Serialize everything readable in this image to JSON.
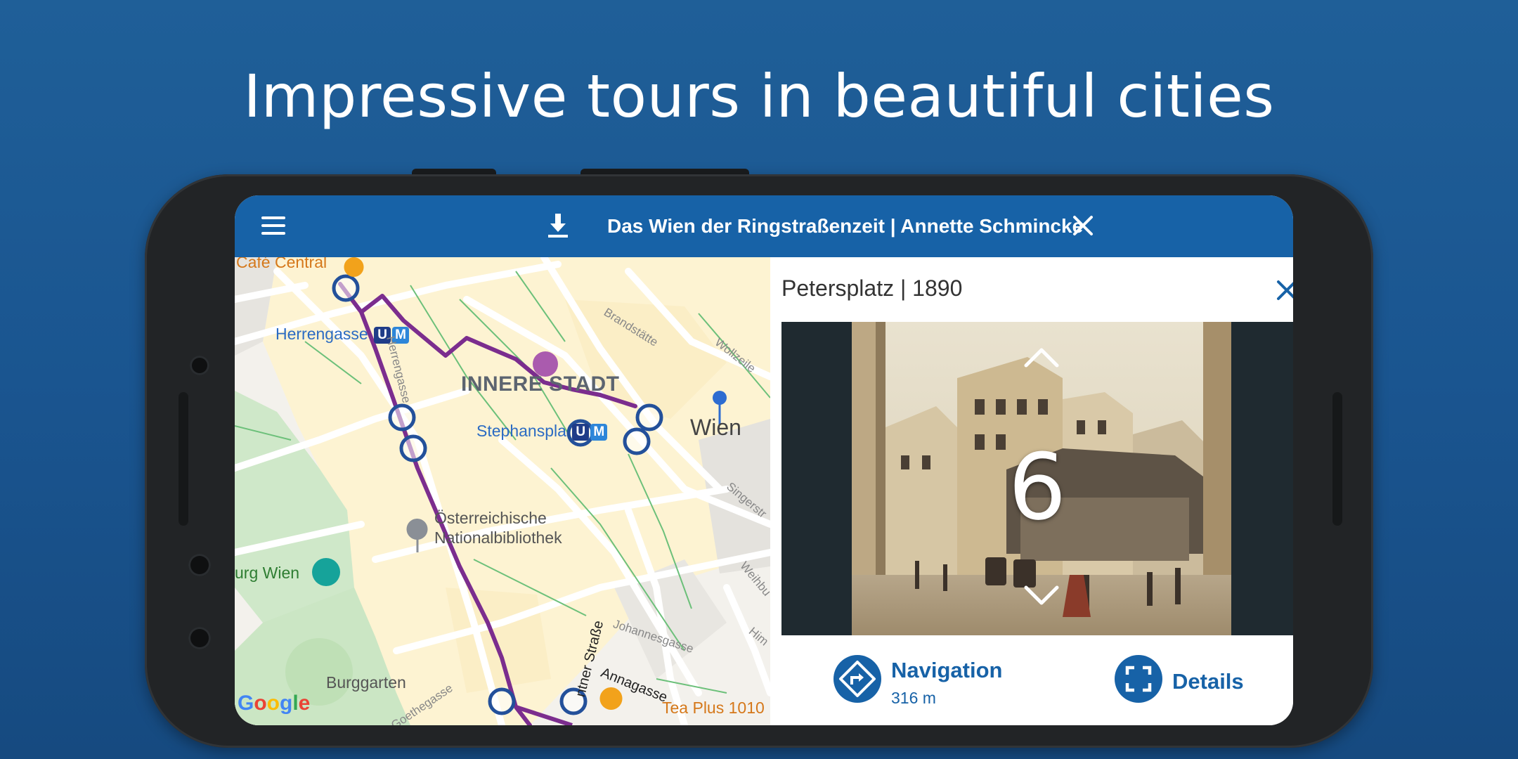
{
  "headline": "Impressive tours in beautiful cities",
  "appbar": {
    "title": "Das Wien der Ringstraßenzeit | Annette Schmincke"
  },
  "map": {
    "labels": {
      "cafe_central": "Café Central",
      "herrengasse": "Herrengasse",
      "innere_stadt": "INNERE STADT",
      "stephansplatz": "Stephanspla",
      "wien": "Wien",
      "nationalbibliothek_1": "Österreichische",
      "nationalbibliothek_2": "Nationalbibliothek",
      "hofburg": "urg Wien",
      "burggarten": "Burggarten",
      "tea_plus": "Tea Plus 1010",
      "brandstaette": "Brandstätte",
      "wollzeile": "Wollzeile",
      "singerstr": "Singerstr",
      "weihbu": "Weihbu",
      "johannesgasse": "Johannesgasse",
      "annagasse": "Annagasse",
      "kaerntner": "ntner Straße",
      "herrengasse_street": "Herrengasse",
      "goethegasse": "Goethegasse",
      "him": "Him"
    },
    "metro": {
      "u": "U",
      "m": "M"
    },
    "attribution": "Google"
  },
  "panel": {
    "title": "Petersplatz | 1890",
    "stop_number": "6",
    "navigation": {
      "label": "Navigation",
      "distance": "316 m"
    },
    "details": {
      "label": "Details"
    }
  },
  "colors": {
    "brand_blue": "#1762a7",
    "route_purple": "#7b2d8e",
    "background": "#1a5590"
  }
}
